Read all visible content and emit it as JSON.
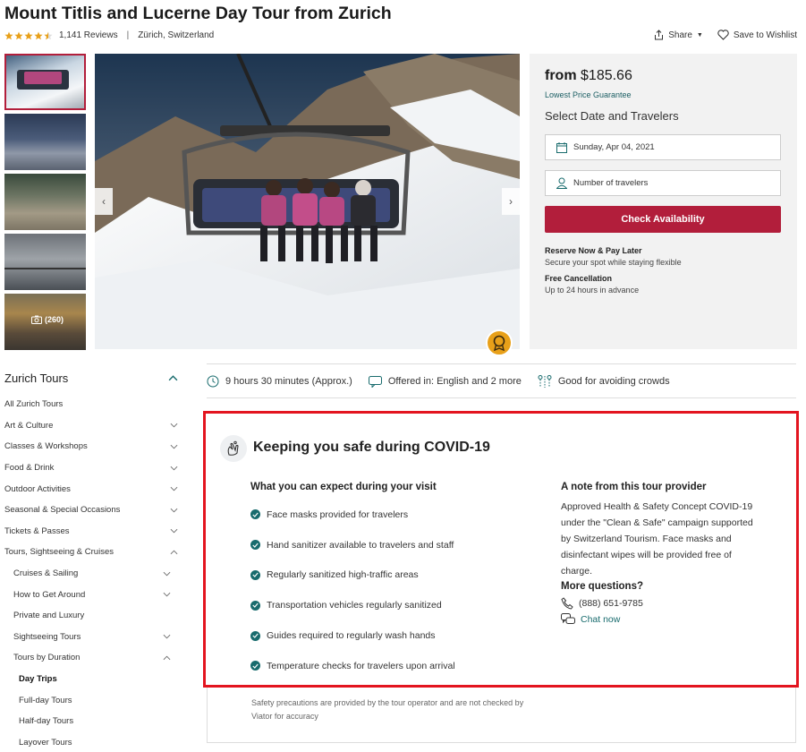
{
  "header": {
    "title": "Mount Titlis and Lucerne Day Tour from Zurich",
    "rating": 4.5,
    "reviews": "1,141 Reviews",
    "location": "Zürich, Switzerland",
    "share_label": "Share",
    "wishlist_label": "Save to Wishlist"
  },
  "gallery": {
    "photo_count": "(260)"
  },
  "booking": {
    "from_label": "from",
    "price": "$185.66",
    "lowest_price": "Lowest Price Guarantee",
    "select_heading": "Select Date and Travelers",
    "date_value": "Sunday, Apr 04, 2021",
    "travelers_placeholder": "Number of travelers",
    "check_button": "Check Availability",
    "reserve_title": "Reserve Now & Pay Later",
    "reserve_desc": "Secure your spot while staying flexible",
    "cancel_title": "Free Cancellation",
    "cancel_desc": "Up to 24 hours in advance"
  },
  "sidebar": {
    "title": "Zurich Tours",
    "items": [
      {
        "label": "All Zurich Tours",
        "level": 0,
        "chevron": "none"
      },
      {
        "label": "Art & Culture",
        "level": 0,
        "chevron": "down"
      },
      {
        "label": "Classes & Workshops",
        "level": 0,
        "chevron": "down"
      },
      {
        "label": "Food & Drink",
        "level": 0,
        "chevron": "down"
      },
      {
        "label": "Outdoor Activities",
        "level": 0,
        "chevron": "down"
      },
      {
        "label": "Seasonal & Special Occasions",
        "level": 0,
        "chevron": "down"
      },
      {
        "label": "Tickets & Passes",
        "level": 0,
        "chevron": "down"
      },
      {
        "label": "Tours, Sightseeing & Cruises",
        "level": 0,
        "chevron": "up"
      },
      {
        "label": "Cruises & Sailing",
        "level": 1,
        "chevron": "down"
      },
      {
        "label": "How to Get Around",
        "level": 1,
        "chevron": "down"
      },
      {
        "label": "Private and Luxury",
        "level": 1,
        "chevron": "none"
      },
      {
        "label": "Sightseeing Tours",
        "level": 1,
        "chevron": "down"
      },
      {
        "label": "Tours by Duration",
        "level": 1,
        "chevron": "up"
      },
      {
        "label": "Day Trips",
        "level": 2,
        "chevron": "none",
        "bold": true
      },
      {
        "label": "Full-day Tours",
        "level": 2,
        "chevron": "none"
      },
      {
        "label": "Half-day Tours",
        "level": 2,
        "chevron": "none"
      },
      {
        "label": "Layover Tours",
        "level": 2,
        "chevron": "none"
      }
    ]
  },
  "facts": {
    "duration": "9 hours 30 minutes (Approx.)",
    "languages": "Offered in: English and 2 more",
    "crowds": "Good for avoiding crowds"
  },
  "covid": {
    "title": "Keeping you safe during COVID-19",
    "expect_heading": "What you can expect during your visit",
    "measures": [
      "Face masks provided for travelers",
      "Hand sanitizer available to travelers and staff",
      "Regularly sanitized high-traffic areas",
      "Transportation vehicles regularly sanitized",
      "Guides required to regularly wash hands",
      "Temperature checks for travelers upon arrival"
    ],
    "note_heading": "A note from this tour provider",
    "note_text": "Approved Health & Safety Concept COVID-19 under the \"Clean & Safe\" campaign supported by Switzerland Tourism. Face masks and disinfectant wipes will be provided free of charge.",
    "more_questions": "More questions?",
    "phone": "(888) 651-9785",
    "chat": "Chat now",
    "disclaimer": "Safety precautions are provided by the tour operator and are not checked by Viator for accuracy"
  },
  "colors": {
    "brand": "#b21e3b",
    "teal": "#186b6d",
    "highlight_border": "#e3141f"
  }
}
